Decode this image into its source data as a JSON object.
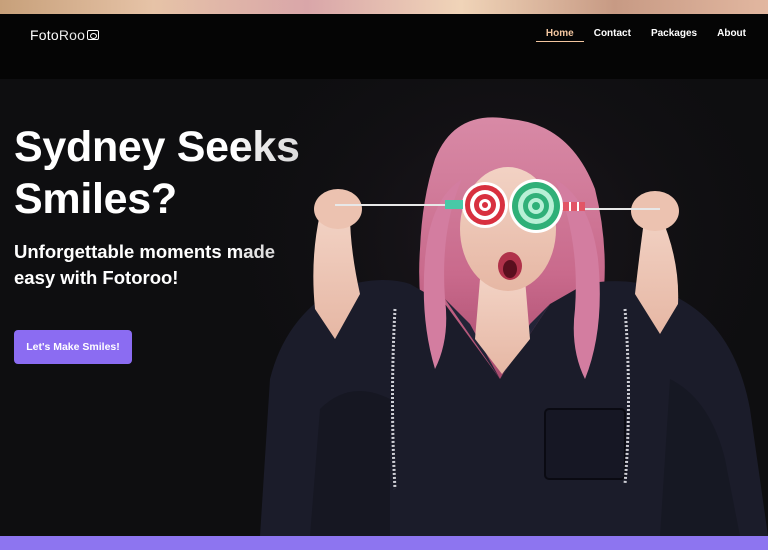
{
  "brand": {
    "logo_foto": "Foto",
    "logo_roo": "Roo"
  },
  "nav": {
    "items": [
      {
        "label": "Home",
        "active": true
      },
      {
        "label": "Contact"
      },
      {
        "label": "Packages"
      },
      {
        "label": "About"
      }
    ]
  },
  "hero": {
    "title": "Sydney Seeks Smiles?",
    "subtitle": "Unforgettable moments made easy with Fotoroo!",
    "cta_label": "Let's Make Smiles!"
  },
  "colors": {
    "accent": "#8b6cf2",
    "nav_active": "#f3c6a0",
    "background": "#0e0e10"
  }
}
